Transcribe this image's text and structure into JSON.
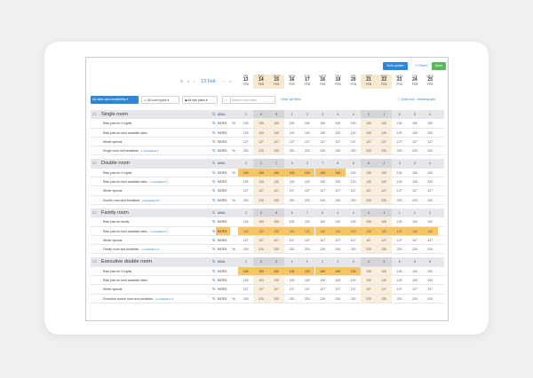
{
  "toolbar": {
    "bulk_label": "Bulk update",
    "reset_label": "Reset",
    "save_label": "Save"
  },
  "datenav": {
    "date": "13 Feb",
    "first": "«",
    "prev": "‹",
    "next": "›",
    "last": "»",
    "refresh": "↻"
  },
  "days": [
    {
      "dow": "FRI",
      "num": "13",
      "mon": "FEB",
      "wk": false
    },
    {
      "dow": "SAT",
      "num": "14",
      "mon": "FEB",
      "wk": true
    },
    {
      "dow": "SUN",
      "num": "15",
      "mon": "FEB",
      "wk": true
    },
    {
      "dow": "MON",
      "num": "16",
      "mon": "FEB",
      "wk": false
    },
    {
      "dow": "TUE",
      "num": "17",
      "mon": "FEB",
      "wk": false
    },
    {
      "dow": "WED",
      "num": "18",
      "mon": "FEB",
      "wk": false
    },
    {
      "dow": "THU",
      "num": "19",
      "mon": "FEB",
      "wk": false
    },
    {
      "dow": "FRI",
      "num": "20",
      "mon": "FEB",
      "wk": false
    },
    {
      "dow": "SAT",
      "num": "21",
      "mon": "FEB",
      "wk": true
    },
    {
      "dow": "SUN",
      "num": "22",
      "mon": "FEB",
      "wk": true
    },
    {
      "dow": "MON",
      "num": "23",
      "mon": "FEB",
      "wk": false
    },
    {
      "dow": "TUE",
      "num": "24",
      "mon": "FEB",
      "wk": false
    },
    {
      "dow": "WED",
      "num": "25",
      "mon": "FEB",
      "wk": false
    }
  ],
  "filters": {
    "all_label": "All rates and availability ▾",
    "room_types": "All room types ▾",
    "rate_plans": "All rate plans ▾",
    "search_placeholder": "Search room rates",
    "clear": "Clear all filters",
    "tour": "Quick tour - inventory grid"
  },
  "labels": {
    "avail": "AVAIL",
    "rates": "RATES",
    "channels": "2 CHANNELS ▾",
    "arrows": "⇅",
    "pct": "%"
  },
  "groups": [
    {
      "name": "Single room",
      "avail": [
        "2",
        "6",
        "5",
        "1",
        "2",
        "3",
        "4",
        "4",
        "2",
        "1",
        "6",
        "5",
        "4"
      ],
      "hl_avail": [],
      "plans": [
        {
          "name": "Rate plan for 3 nights",
          "chan": false,
          "pct": true,
          "hl_all": false,
          "hl": [],
          "values": [
            "100",
            "100",
            "100",
            "100",
            "100",
            "100",
            "100",
            "100",
            "100",
            "100",
            "100",
            "100",
            "100"
          ]
        },
        {
          "name": "Rate plan for best available rates",
          "chan": false,
          "pct": false,
          "hl_all": false,
          "hl": [],
          "values": [
            "120",
            "120",
            "120",
            "120",
            "120",
            "120",
            "120",
            "120",
            "120",
            "120",
            "120",
            "120",
            "120"
          ]
        },
        {
          "name": "Winter special",
          "chan": false,
          "pct": false,
          "hl_all": false,
          "hl": [],
          "values": [
            "127",
            "127",
            "127",
            "127",
            "127",
            "127",
            "127",
            "127",
            "127",
            "127",
            "127",
            "127",
            "127"
          ]
        },
        {
          "name": "Single room and breakfast",
          "chan": true,
          "pct": true,
          "hl_all": false,
          "hl": [],
          "values": [
            "220",
            "220",
            "220",
            "220",
            "220",
            "220",
            "220",
            "220",
            "220",
            "220",
            "220",
            "220",
            "220"
          ]
        }
      ]
    },
    {
      "name": "Double room",
      "avail": [
        "2",
        "1",
        "7",
        "3",
        "2",
        "7",
        "8",
        "5",
        "6",
        "2",
        "3",
        "3",
        "4"
      ],
      "hl_avail": [],
      "plans": [
        {
          "name": "Rate plan for 3 nights",
          "chan": false,
          "pct": true,
          "hl_all": false,
          "hl": [
            0,
            1,
            2,
            3,
            4,
            5,
            6
          ],
          "values": [
            "100",
            "100",
            "100",
            "100",
            "100",
            "100",
            "100",
            "100",
            "100",
            "100",
            "100",
            "100",
            "100"
          ]
        },
        {
          "name": "Rate plan for best available rates",
          "chan": true,
          "pct": false,
          "hl_all": false,
          "hl": [],
          "values": [
            "120",
            "120",
            "120",
            "120",
            "120",
            "120",
            "120",
            "120",
            "120",
            "120",
            "120",
            "120",
            "120"
          ]
        },
        {
          "name": "Winter special",
          "chan": false,
          "pct": false,
          "hl_all": false,
          "hl": [],
          "values": [
            "127",
            "127",
            "127",
            "127",
            "127",
            "127",
            "127",
            "127",
            "127",
            "127",
            "127",
            "127",
            "127"
          ]
        },
        {
          "name": "Double room and breakfast",
          "chan": true,
          "pct": true,
          "hl_all": false,
          "hl": [],
          "values": [
            "220",
            "220",
            "220",
            "220",
            "220",
            "220",
            "220",
            "220",
            "220",
            "220",
            "220",
            "220",
            "220"
          ]
        }
      ]
    },
    {
      "name": "Family room",
      "avail": [
        "2",
        "4",
        "6",
        "6",
        "7",
        "5",
        "4",
        "4",
        "4",
        "4",
        "1",
        "1",
        "2"
      ],
      "hl_avail": [],
      "plans": [
        {
          "name": "Rate plan for family",
          "chan": false,
          "pct": false,
          "hl_all": false,
          "hl": [],
          "values": [
            "100",
            "100",
            "100",
            "100",
            "100",
            "100",
            "100",
            "100",
            "100",
            "100",
            "100",
            "100",
            "100"
          ]
        },
        {
          "name": "Rate plan for best available rates",
          "chan": true,
          "pct": false,
          "hl_all": true,
          "hl": [],
          "values": [
            "120",
            "120",
            "120",
            "120",
            "120",
            "120",
            "120",
            "120",
            "120",
            "120",
            "120",
            "120",
            "120"
          ]
        },
        {
          "name": "Winter special",
          "chan": false,
          "pct": false,
          "hl_all": false,
          "hl": [],
          "values": [
            "127",
            "127",
            "127",
            "127",
            "127",
            "127",
            "127",
            "127",
            "127",
            "127",
            "127",
            "127",
            "127"
          ]
        },
        {
          "name": "Family room and breakfast",
          "chan": true,
          "pct": true,
          "hl_all": false,
          "hl": [],
          "values": [
            "220",
            "220",
            "220",
            "220",
            "220",
            "220",
            "220",
            "220",
            "220",
            "220",
            "220",
            "220",
            "220"
          ]
        }
      ]
    },
    {
      "name": "Executive double room",
      "avail": [
        "2",
        "5",
        "6",
        "4",
        "1",
        "2",
        "2",
        "3",
        "4",
        "5",
        "5",
        "5",
        "5"
      ],
      "hl_avail": [],
      "plans": [
        {
          "name": "Rate plan for 3 nights",
          "chan": false,
          "pct": false,
          "hl_all": false,
          "hl": [
            0,
            1,
            2,
            3,
            4,
            5,
            6,
            7
          ],
          "values": [
            "100",
            "100",
            "100",
            "100",
            "100",
            "100",
            "100",
            "100",
            "100",
            "100",
            "100",
            "100",
            "100"
          ]
        },
        {
          "name": "Rate plan for best available rates",
          "chan": false,
          "pct": false,
          "hl_all": false,
          "hl": [],
          "values": [
            "120",
            "120",
            "120",
            "120",
            "120",
            "120",
            "120",
            "120",
            "120",
            "120",
            "120",
            "120",
            "120"
          ]
        },
        {
          "name": "Winter special",
          "chan": false,
          "pct": false,
          "hl_all": false,
          "hl": [],
          "values": [
            "127",
            "127",
            "127",
            "127",
            "127",
            "127",
            "127",
            "127",
            "127",
            "127",
            "127",
            "127",
            "127"
          ]
        },
        {
          "name": "Executive double room and breakfast",
          "chan": true,
          "pct": true,
          "hl_all": false,
          "hl": [],
          "values": [
            "220",
            "220",
            "220",
            "220",
            "220",
            "220",
            "220",
            "220",
            "220",
            "220",
            "220",
            "220",
            "220"
          ]
        }
      ]
    }
  ]
}
